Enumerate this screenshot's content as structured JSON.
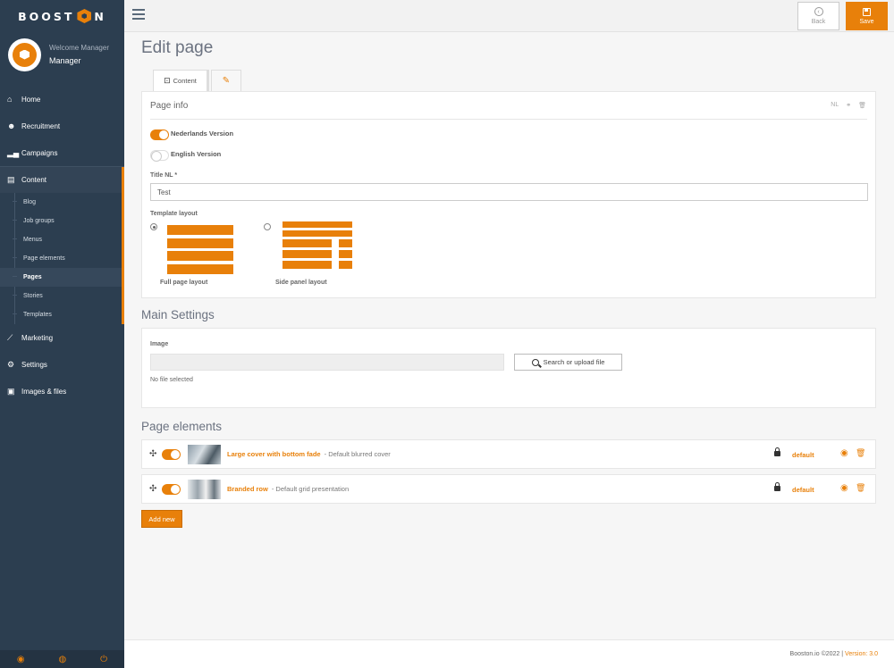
{
  "app": {
    "logo_text_left": "BOOST",
    "logo_text_right": "N"
  },
  "user": {
    "welcome": "Welcome Manager",
    "name": "Manager"
  },
  "sidebar": {
    "items": [
      {
        "label": "Home",
        "icon": "home-icon"
      },
      {
        "label": "Recruitment",
        "icon": "users-icon"
      },
      {
        "label": "Campaigns",
        "icon": "signal-icon"
      },
      {
        "label": "Content",
        "icon": "file-icon"
      },
      {
        "label": "Marketing",
        "icon": "chart-line-icon"
      },
      {
        "label": "Settings",
        "icon": "gears-icon"
      },
      {
        "label": "Images & files",
        "icon": "image-icon"
      }
    ],
    "content_sub": [
      "Blog",
      "Job groups",
      "Menus",
      "Page elements",
      "Pages",
      "Stories",
      "Templates"
    ],
    "current_sub": "Pages"
  },
  "toolbar": {
    "back_label": "Back",
    "save_label": "Save"
  },
  "page": {
    "title": "Edit page",
    "tab_content": "Content"
  },
  "page_info": {
    "heading": "Page info",
    "lang_badge": "NL",
    "dutch_label": "Nederlands Version",
    "dutch_on": true,
    "english_label": "English Version",
    "english_on": false,
    "title_label": "Title NL *",
    "title_value": "Test",
    "template_label": "Template layout",
    "layout_full": "Full page layout",
    "layout_side": "Side panel layout",
    "selected_layout": "Full page layout"
  },
  "main_settings": {
    "heading": "Main Settings",
    "image_label": "Image",
    "search_button": "Search or upload file",
    "no_file": "No file selected"
  },
  "page_elements": {
    "heading": "Page elements",
    "items": [
      {
        "name": "Large cover with bottom fade",
        "desc": "- Default blurred cover",
        "tag": "default",
        "enabled": true
      },
      {
        "name": "Branded row",
        "desc": "- Default grid presentation",
        "tag": "default",
        "enabled": true
      }
    ],
    "add_button": "Add new"
  },
  "footer": {
    "copyright": "Booston.io ©2022 |",
    "version": "Version: 3.0"
  },
  "colors": {
    "accent": "#e8800a",
    "sidebar_bg": "#2c3e50"
  }
}
